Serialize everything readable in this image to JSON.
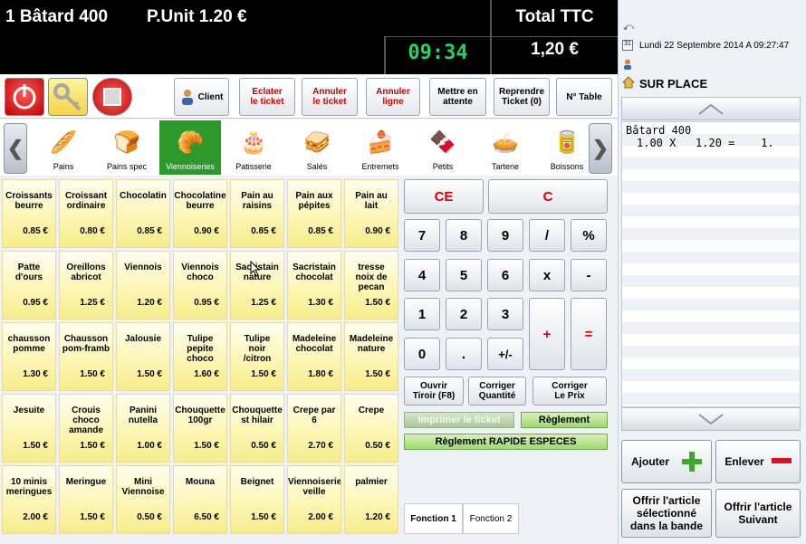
{
  "display": {
    "item": "1 Bâtard 400",
    "unit_price": "P.Unit  1.20 €",
    "clock": "09:34",
    "total_label": "Total TTC",
    "total_value": "1,20 €"
  },
  "info": {
    "date": "Lundi 22 Septembre 2014 A 09:27:47",
    "mode": "SUR PLACE"
  },
  "ticket": {
    "lines": [
      {
        "name": "Bâtard 400",
        "detail": "1.00 X   1.20 =    1."
      }
    ]
  },
  "toolbar": {
    "client": "Client",
    "split": "Eclater\nle ticket",
    "cancel_ticket": "Annuler\nle ticket",
    "cancel_line": "Annuler\nligne",
    "hold": "Mettre en\nattente",
    "resume": "Reprendre\nTicket (0)",
    "table": "N° Table"
  },
  "categories": [
    {
      "label": "Pains",
      "icon": "bread-icon"
    },
    {
      "label": "Pains spec",
      "icon": "round-bread-icon"
    },
    {
      "label": "Viennoiseries",
      "icon": "croissant-icon"
    },
    {
      "label": "Patisserie",
      "icon": "cake-icon"
    },
    {
      "label": "Salés",
      "icon": "sandwich-icon"
    },
    {
      "label": "Entremets",
      "icon": "cake-slice-icon"
    },
    {
      "label": "Petits",
      "icon": "small-cake-icon"
    },
    {
      "label": "Tarterie",
      "icon": "tart-icon"
    },
    {
      "label": "Boissons",
      "icon": "can-icon"
    }
  ],
  "products": [
    [
      {
        "name": "Croissants\nbeurre",
        "price": "0.85 €"
      },
      {
        "name": "Croissant\nordinaire",
        "price": "0.80 €"
      },
      {
        "name": "Chocolatin",
        "price": "0.85 €"
      },
      {
        "name": "Chocolatine\nbeurre",
        "price": "0.90 €"
      },
      {
        "name": "Pain au\nraisins",
        "price": "0.85 €"
      },
      {
        "name": "Pain aux\npépites",
        "price": "0.85 €"
      },
      {
        "name": "Pain au\nlait",
        "price": "0.90 €"
      }
    ],
    [
      {
        "name": "Patte\nd'ours",
        "price": "0.95 €"
      },
      {
        "name": "Oreillons\nabricot",
        "price": "1.25 €"
      },
      {
        "name": "Viennois",
        "price": "1.20 €"
      },
      {
        "name": "Viennois\nchoco",
        "price": "0.95 €"
      },
      {
        "name": "Sacristain\nnature",
        "price": "1.25 €"
      },
      {
        "name": "Sacristain\nchocolat",
        "price": "1.30 €"
      },
      {
        "name": "tresse\nnoix de\npecan",
        "price": "1.50 €"
      }
    ],
    [
      {
        "name": "chausson\npomme",
        "price": "1.30 €"
      },
      {
        "name": "Chausson\npom-framb",
        "price": "1.50 €"
      },
      {
        "name": "Jalousie",
        "price": "1.50 €"
      },
      {
        "name": "Tulipe\npepite\nchoco",
        "price": "1.60 €"
      },
      {
        "name": "Tulipe\nnoir\n/citron",
        "price": "1.50 €"
      },
      {
        "name": "Madeleine\nchocolat",
        "price": "1.80 €"
      },
      {
        "name": "Madeleine\nnature",
        "price": "1.50 €"
      }
    ],
    [
      {
        "name": "Jesuite",
        "price": "1.50 €"
      },
      {
        "name": "Crouis\nchoco\namande",
        "price": "1.50 €"
      },
      {
        "name": "Panini\nnutella",
        "price": "1.00 €"
      },
      {
        "name": "Chouquette\n100gr",
        "price": "1.50 €"
      },
      {
        "name": "Chouquette\nst hilair",
        "price": "0.50 €"
      },
      {
        "name": "Crepe par\n6",
        "price": "2.70 €"
      },
      {
        "name": "Crepe",
        "price": "0.50 €"
      }
    ],
    [
      {
        "name": "10 minis\nmeringues",
        "price": "2.00 €"
      },
      {
        "name": "Meringue",
        "price": "1.50 €"
      },
      {
        "name": "Mini\nViennoise",
        "price": "0.50 €"
      },
      {
        "name": "Mouna",
        "price": "6.50 €"
      },
      {
        "name": "Beignet",
        "price": "1.50 €"
      },
      {
        "name": "Viennoiserie\nveille",
        "price": "2.00 €"
      },
      {
        "name": "palmier",
        "price": "1.20 €"
      }
    ]
  ],
  "keypad": {
    "ce": "CE",
    "c": "C",
    "k7": "7",
    "k8": "8",
    "k9": "9",
    "div": "/",
    "pct": "%",
    "k4": "4",
    "k5": "5",
    "k6": "6",
    "mul": "x",
    "minus": "-",
    "k1": "1",
    "k2": "2",
    "k3": "3",
    "plus": "+",
    "eq": "=",
    "k0": "0",
    "dot": ".",
    "sign": "+/-",
    "drawer": "Ouvrir\nTiroir (F8)",
    "fix_qty": "Corriger\nQuantité",
    "fix_price": "Corriger\nLe Prix",
    "print": "Imprimer le ticket",
    "payment": "Règlement",
    "quick_cash": "Règlement RAPIDE ESPECES",
    "fn1": "Fonction 1",
    "fn2": "Fonction 2"
  },
  "actions": {
    "add": "Ajouter",
    "remove": "Enlever",
    "offer_selected": "Offrir l'article\nsélectionné\ndans la bande",
    "offer_next": "Offrir l'article\nSuivant"
  },
  "colors": {
    "accent_green": "#2b9a2b",
    "clock_green": "#2bd15a",
    "red": "#e00000"
  }
}
